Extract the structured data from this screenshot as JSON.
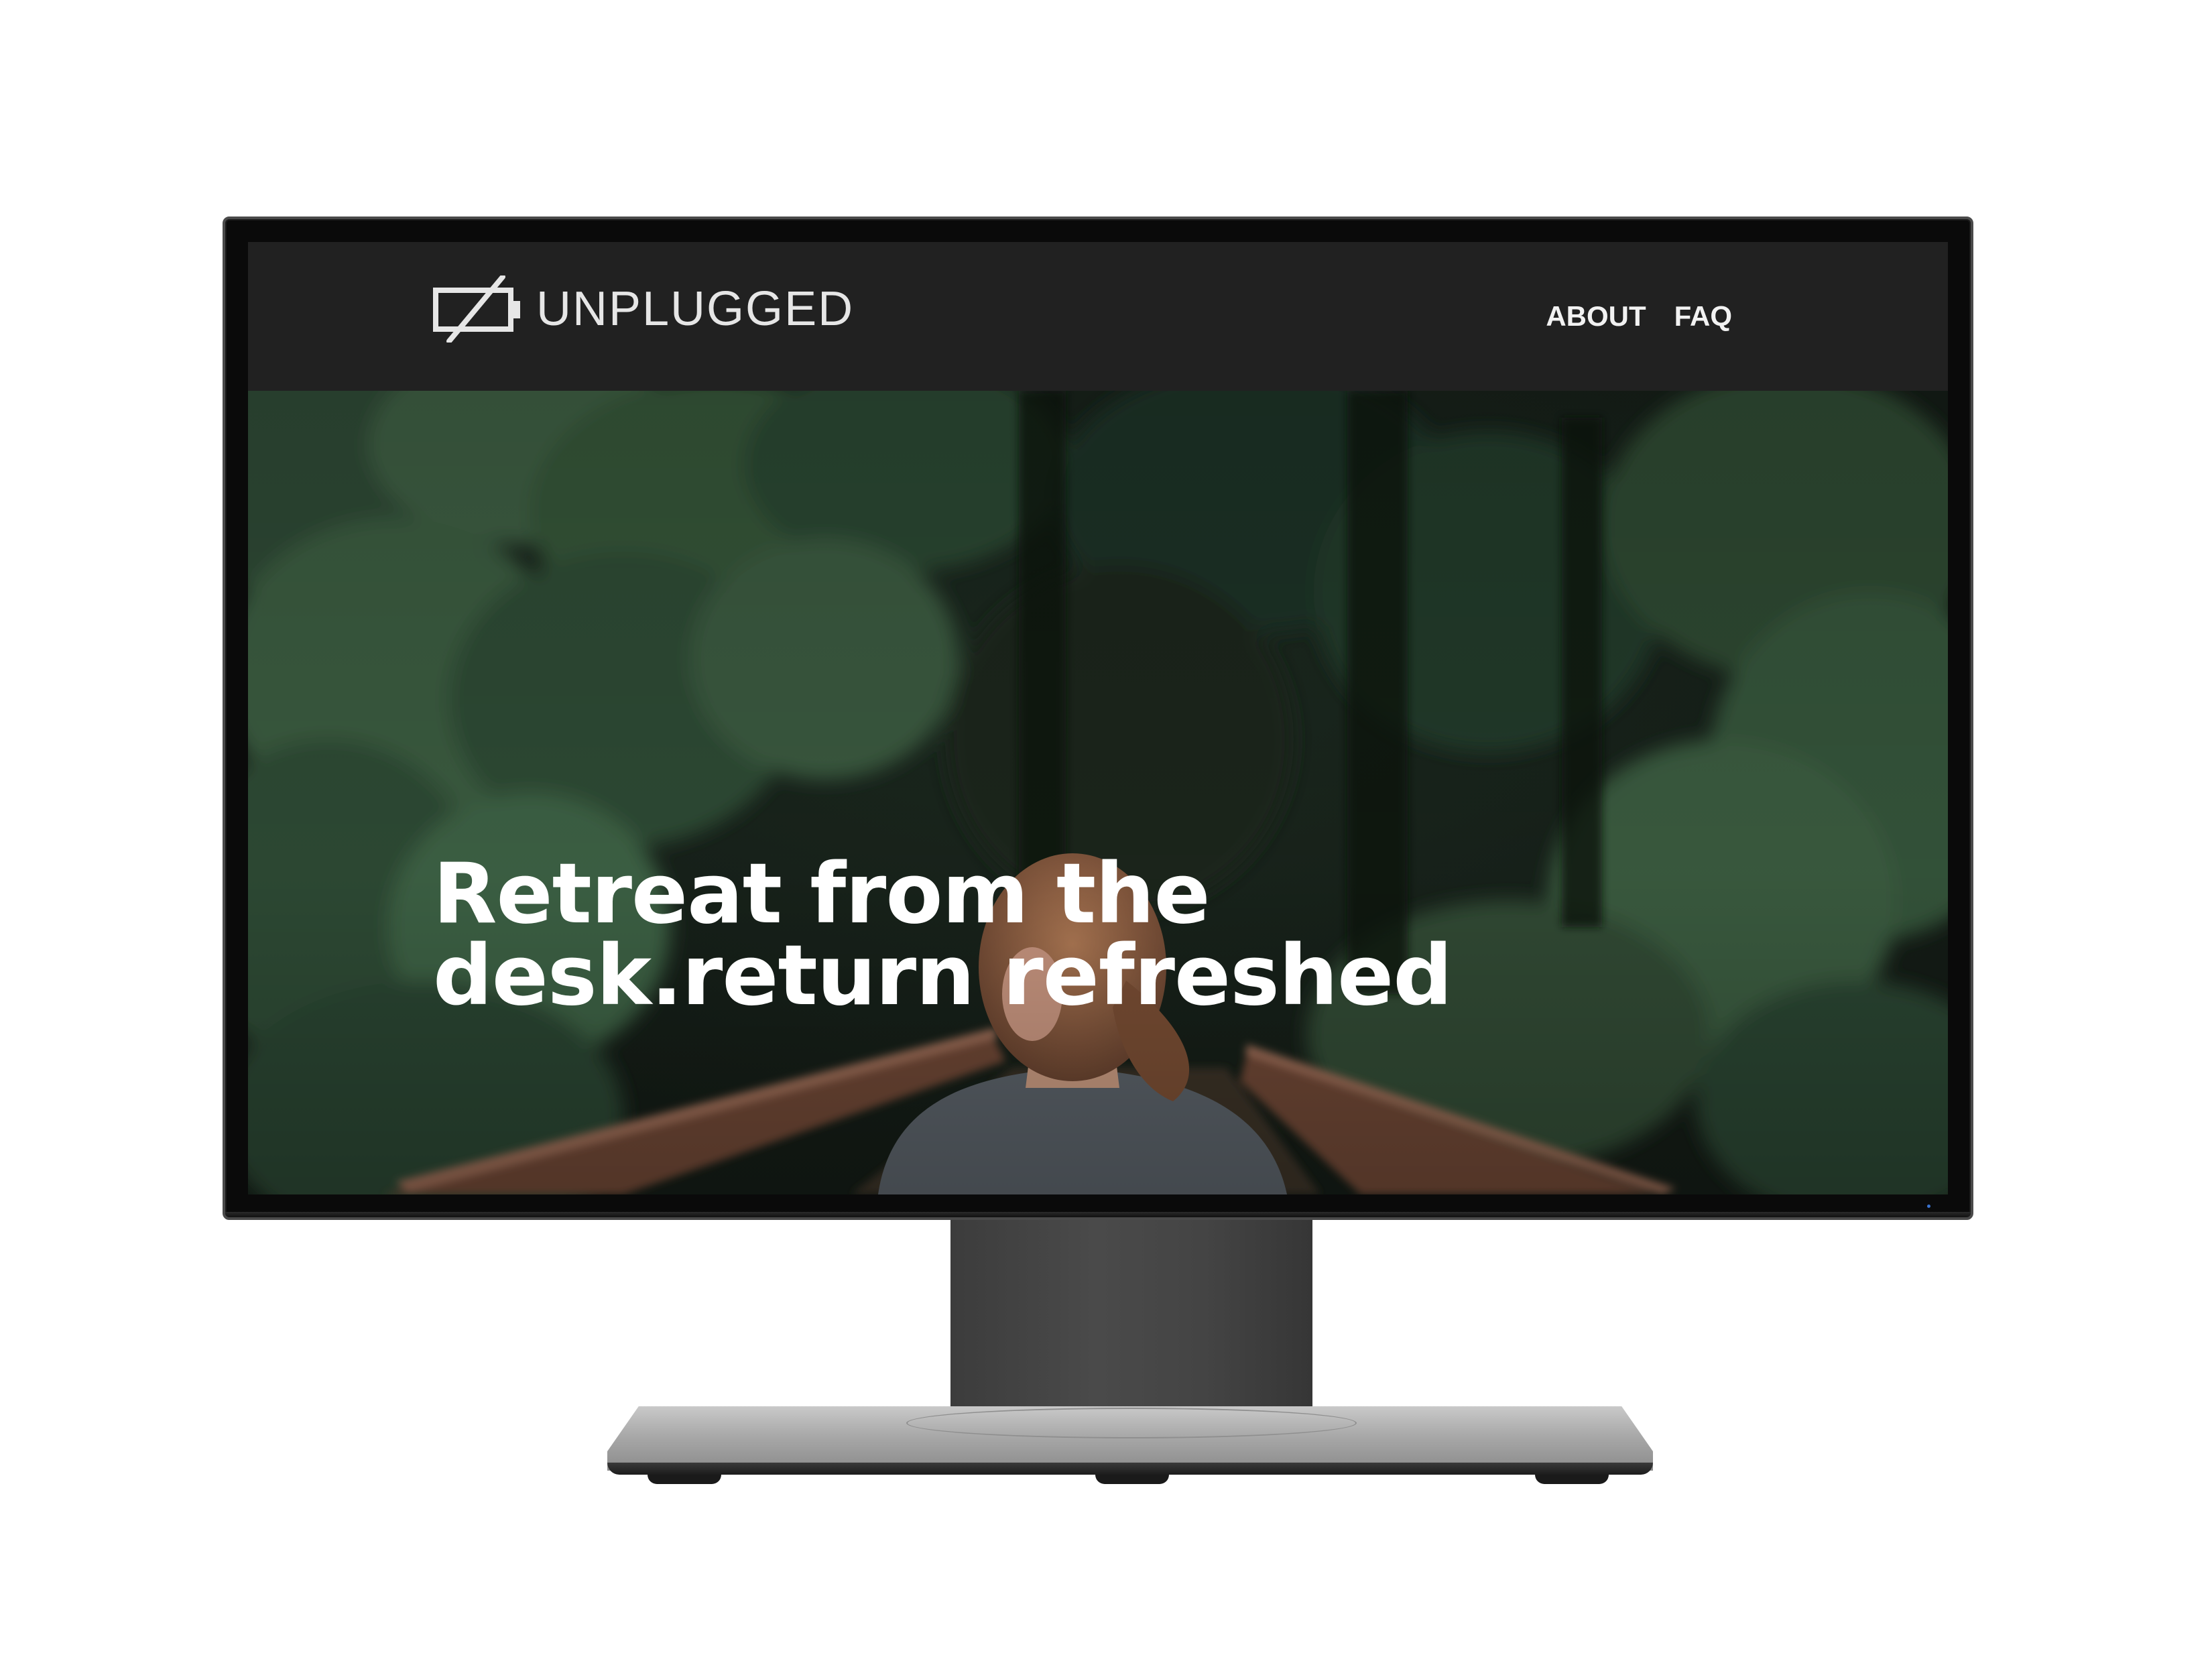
{
  "site": {
    "brand_name": "UNPLUGGED",
    "brand_icon": "battery-slash-icon",
    "nav": [
      {
        "label": "ABOUT"
      },
      {
        "label": "FAQ"
      }
    ]
  },
  "hero": {
    "title_line1": "Retreat from the",
    "title_line2": "desk.return refreshed",
    "image": "woman-on-forest-bridge-photo"
  },
  "colors": {
    "header_bg": "#212121",
    "header_text": "#e6e6e6",
    "hero_text": "#ffffff",
    "forest_green": "#2e4a34",
    "bridge_rail": "#8a5a44"
  }
}
